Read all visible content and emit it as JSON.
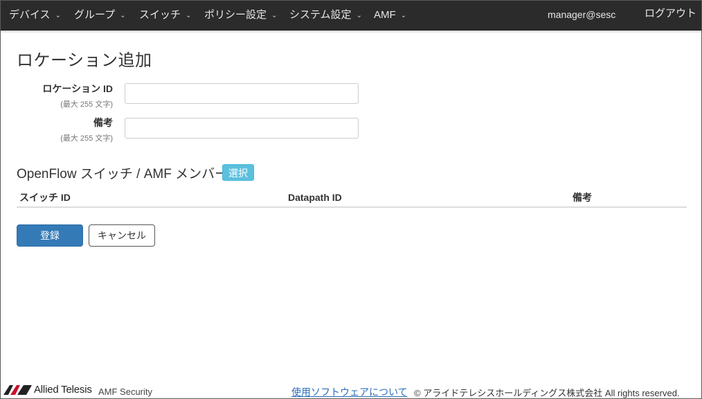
{
  "nav": {
    "items": [
      {
        "label": "デバイス"
      },
      {
        "label": "グループ"
      },
      {
        "label": "スイッチ"
      },
      {
        "label": "ポリシー設定"
      },
      {
        "label": "システム設定"
      },
      {
        "label": "AMF"
      }
    ],
    "caret": "⌄",
    "user": "manager@sesc",
    "logout": "ログアウト"
  },
  "page": {
    "title": "ロケーション追加"
  },
  "form": {
    "location_id": {
      "label": "ロケーション ID",
      "hint": "(最大 255 文字)",
      "value": ""
    },
    "remarks": {
      "label": "備考",
      "hint": "(最大 255 文字)",
      "value": ""
    }
  },
  "members": {
    "title": "OpenFlow スイッチ / AMF メンバー",
    "select_label": "選択",
    "columns": [
      "スイッチ ID",
      "Datapath ID",
      "備考"
    ],
    "rows": []
  },
  "actions": {
    "register": "登録",
    "cancel": "キャンセル"
  },
  "footer": {
    "brand": "Allied Telesis",
    "product": "AMF Security",
    "link": "使用ソフトウェアについて",
    "copyright": "© アライドテレシスホールディングス株式会社 All rights reserved."
  },
  "colors": {
    "navbar": "#2b2b2b",
    "primary": "#337ab7",
    "info": "#5bc0de",
    "link": "#2a6ebb"
  }
}
